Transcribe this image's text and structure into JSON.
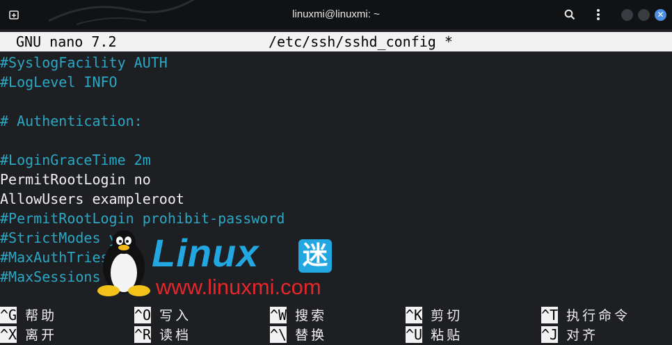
{
  "window": {
    "title": "linuxmi@linuxmi: ~",
    "icons": [
      "new-tab-icon",
      "search-icon",
      "kebab-menu-icon",
      "minimize-icon",
      "maximize-icon",
      "close-icon"
    ]
  },
  "nano": {
    "version": "GNU nano 7.2",
    "file": "/etc/ssh/sshd_config *"
  },
  "editor": {
    "lines": [
      {
        "text": "#SyslogFacility AUTH",
        "kind": "comment"
      },
      {
        "text": "#LogLevel INFO",
        "kind": "comment"
      },
      {
        "text": "",
        "kind": "plain"
      },
      {
        "text": "# Authentication:",
        "kind": "comment"
      },
      {
        "text": "",
        "kind": "plain"
      },
      {
        "text": "#LoginGraceTime 2m",
        "kind": "comment"
      },
      {
        "text": "PermitRootLogin no",
        "kind": "plain"
      },
      {
        "text": "AllowUsers exampleroot",
        "kind": "plain"
      },
      {
        "text": "#PermitRootLogin prohibit-password",
        "kind": "comment"
      },
      {
        "text": "#StrictModes yes",
        "kind": "comment"
      },
      {
        "text": "#MaxAuthTries 6",
        "kind": "comment"
      },
      {
        "text": "#MaxSessions 10",
        "kind": "comment"
      }
    ]
  },
  "shortcuts": [
    {
      "key": "^G",
      "label": "帮助"
    },
    {
      "key": "^O",
      "label": "写入"
    },
    {
      "key": "^W",
      "label": "搜索"
    },
    {
      "key": "^K",
      "label": "剪切"
    },
    {
      "key": "^T",
      "label": "执行命令"
    },
    {
      "key": "^X",
      "label": "离开"
    },
    {
      "key": "^R",
      "label": "读档"
    },
    {
      "key": "^\\",
      "label": "替换"
    },
    {
      "key": "^U",
      "label": "粘贴"
    },
    {
      "key": "^J",
      "label": "对齐"
    }
  ],
  "watermark": {
    "brand": "Linux",
    "brand_cn": "迷",
    "url": "www.linuxmi.com"
  },
  "colors": {
    "comment": "#2aa8c4",
    "header_bg": "#f2f2f2",
    "brand_blue": "#22a7e0",
    "brand_red": "#e5272b"
  }
}
